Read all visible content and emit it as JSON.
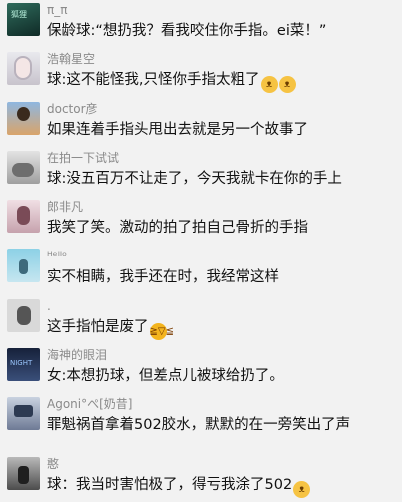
{
  "comments": [
    {
      "author": "π_π",
      "text": "保龄球:“想扔我？看我咬住你手指。ei菜！”",
      "emoji": []
    },
    {
      "author": "浩翰星空",
      "text": "球:这不能怪我,只怪你手指太粗了",
      "emoji": [
        "cat-face",
        "cat-face"
      ]
    },
    {
      "author": "doctor彦",
      "text": "如果连着手指头甩出去就是另一个故事了",
      "emoji": []
    },
    {
      "author": "在拍一下试试",
      "text": "球:没五百万不让走了，今天我就卡在你的手上",
      "emoji": []
    },
    {
      "author": "郎非凡",
      "text": "我笑了笑。激动的拍了拍自己骨折的手指",
      "emoji": []
    },
    {
      "author": "ᴴᵉᴵᴵᵒ",
      "text": "实不相瞒，我手还在时，我经常这样",
      "emoji": []
    },
    {
      "author": ".",
      "text": "这手指怕是废了",
      "emoji": [
        "laughing-face"
      ]
    },
    {
      "author": "海神的眼泪",
      "text": "女:本想扔球，但差点儿被球给扔了。",
      "emoji": []
    },
    {
      "author": "Agoni°ぺ[奶昔]",
      "text": "罪魁祸首拿着502胶水，默默的在一旁笑出了声",
      "emoji": []
    },
    {
      "author": "憨",
      "text": "球：我当时害怕极了，得亏我涂了502",
      "emoji": [
        "cat-face"
      ]
    }
  ],
  "avatar_labels": {
    "a1": "狐狸",
    "a8": "NIGHT"
  }
}
